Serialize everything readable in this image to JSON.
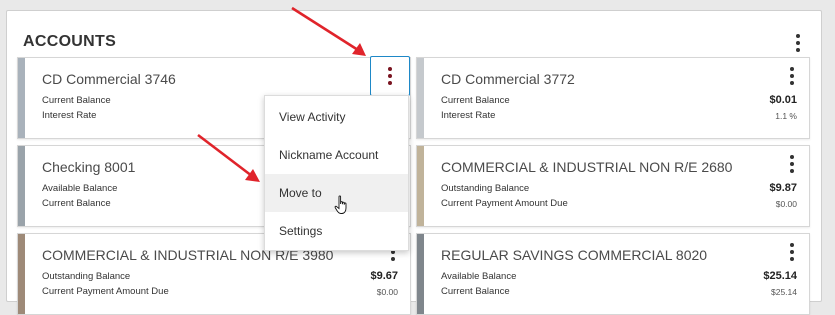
{
  "header": {
    "title": "ACCOUNTS",
    "more_icon": "vertical-ellipsis-icon"
  },
  "accounts": [
    {
      "name": "CD Commercial 3746",
      "color": "#a9b2bb",
      "rows": [
        {
          "label": "Current Balance",
          "value": ""
        },
        {
          "label": "Interest Rate",
          "value": ""
        }
      ]
    },
    {
      "name": "CD Commercial 3772",
      "color": "#c5c9cd",
      "rows": [
        {
          "label": "Current Balance",
          "value": "$0.01"
        },
        {
          "label": "Interest Rate",
          "value": "1.1 %"
        }
      ]
    },
    {
      "name": "Checking 8001",
      "color": "#9aa3aa",
      "rows": [
        {
          "label": "Available Balance",
          "value": ""
        },
        {
          "label": "Current Balance",
          "value": ""
        }
      ]
    },
    {
      "name": "COMMERCIAL & INDUSTRIAL NON R/E 2680",
      "color": "#c0b39a",
      "rows": [
        {
          "label": "Outstanding Balance",
          "value": "$9.87"
        },
        {
          "label": "Current Payment Amount Due",
          "value": "$0.00"
        }
      ]
    },
    {
      "name": "COMMERCIAL & INDUSTRIAL NON R/E 3980",
      "color": "#9e8a78",
      "rows": [
        {
          "label": "Outstanding Balance",
          "value": "$9.67"
        },
        {
          "label": "Current Payment Amount Due",
          "value": "$0.00"
        }
      ]
    },
    {
      "name": "REGULAR SAVINGS COMMERCIAL 8020",
      "color": "#7f868c",
      "rows": [
        {
          "label": "Available Balance",
          "value": "$25.14"
        },
        {
          "label": "Current Balance",
          "value": "$25.14"
        }
      ]
    }
  ],
  "context_menu": {
    "items": [
      {
        "label": "View Activity"
      },
      {
        "label": "Nickname Account"
      },
      {
        "label": "Move to"
      },
      {
        "label": "Settings"
      }
    ]
  },
  "annotations": {
    "arrow_color": "#e0242b"
  }
}
